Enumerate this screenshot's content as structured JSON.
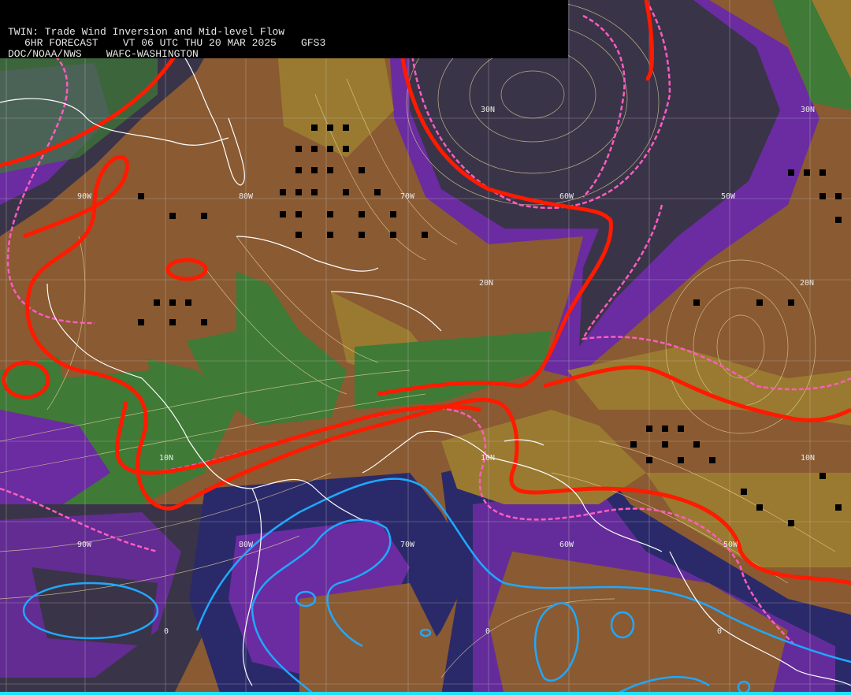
{
  "header": {
    "line1": "TWIN: Trade Wind Inversion and Mid-level Flow",
    "line2": "6HR FORECAST    VT 06 UTC THU 20 MAR 2025    GFS3",
    "line3": "DOC/NOAA/NWS    WAFC-WASHINGTON"
  },
  "labels": {
    "lat30_a": "30N",
    "lat30_b": "30N",
    "lat20_a": "20N",
    "lat20_b": "20N",
    "lat10_a": "10N",
    "lat10_b": "10N",
    "lat10_c": "10N",
    "lon90_top": "90W",
    "lon80_top": "80W",
    "lon70_top": "70W",
    "lon60_top": "60W",
    "lon50_top": "50W",
    "lon90_bot": "90W",
    "lon80_bot": "80W",
    "lon70_bot": "70W",
    "lon60_bot": "60W",
    "lon50_bot": "50W",
    "eq_a": "0",
    "eq_b": "0",
    "eq_c": "0"
  },
  "colors": {
    "brown": "#8a5a32",
    "olive": "#9a7a30",
    "green": "#3f7a36",
    "purple": "#6a2ca0",
    "navy": "#2a2a6a",
    "darkgray": "#3a3448",
    "red": "#ff1a00",
    "pink": "#ff5cc0",
    "cyan": "#20a8ff",
    "coast": "#ffffff",
    "stream": "#e8d8a0"
  }
}
